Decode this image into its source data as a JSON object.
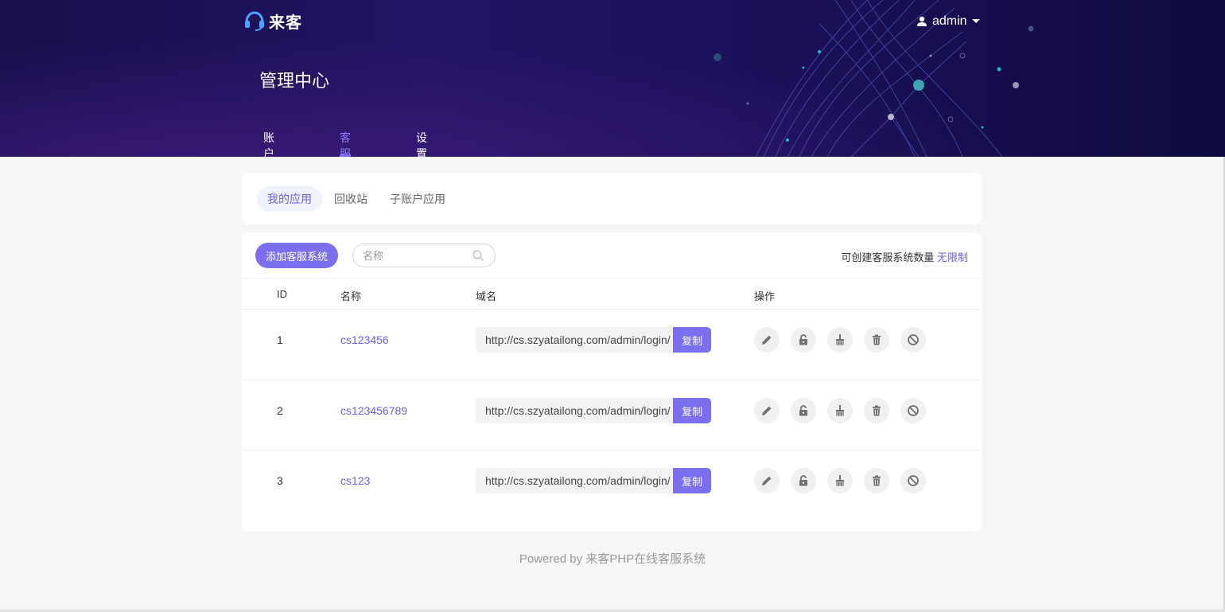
{
  "brand": {
    "name": "来客"
  },
  "user": {
    "name": "admin"
  },
  "page_title": "管理中心",
  "main_nav": [
    {
      "label": "账户管理",
      "active": false
    },
    {
      "label": "客服系统",
      "active": true
    },
    {
      "label": "设置",
      "active": false
    }
  ],
  "sub_tabs": [
    {
      "label": "我的应用",
      "active": true
    },
    {
      "label": "回收站",
      "active": false
    },
    {
      "label": "子账户应用",
      "active": false
    }
  ],
  "toolbar": {
    "add_label": "添加客服系统",
    "search_placeholder": "名称",
    "quota_label": "可创建客服系统数量",
    "quota_value": "无限制"
  },
  "table": {
    "columns": [
      "ID",
      "名称",
      "域名",
      "操作"
    ],
    "copy_label": "复制",
    "rows": [
      {
        "id": "1",
        "name": "cs123456",
        "domain": "http://cs.szyatailong.com/admin/login/"
      },
      {
        "id": "2",
        "name": "cs123456789",
        "domain": "http://cs.szyatailong.com/admin/login/"
      },
      {
        "id": "3",
        "name": "cs123",
        "domain": "http://cs.szyatailong.com/admin/login/"
      }
    ],
    "actions": [
      "pencil-icon",
      "unlock-icon",
      "broom-icon",
      "trash-icon",
      "ban-icon"
    ]
  },
  "footer": "Powered by 来客PHP在线客服系统",
  "colors": {
    "accent": "#7b6ef0",
    "link": "#6d5fe8",
    "header_bg": "#1b1058"
  }
}
